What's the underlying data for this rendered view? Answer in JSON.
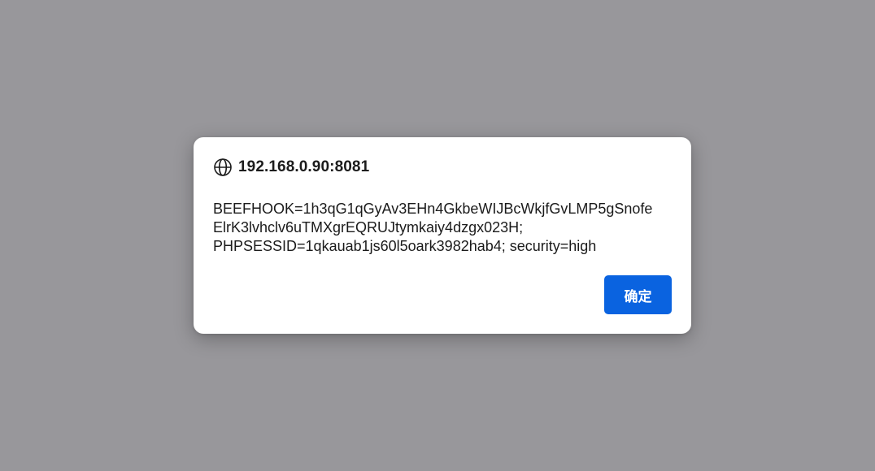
{
  "dialog": {
    "origin": "192.168.0.90:8081",
    "origin_icon": "globe-icon",
    "message_lines": [
      "BEEFHOOK=1h3qG1qGyAv3EHn4GkbeWIJBcWkjfGvLMP5gSnofe",
      "ElrK3lvhclv6uTMXgrEQRUJtymkaiy4dzgx023H;",
      "PHPSESSID=1qkauab1js60l5oark3982hab4; security=high"
    ],
    "ok_label": "确定"
  },
  "colors": {
    "backdrop": "#98979b",
    "dialog_background": "#ffffff",
    "button_accent": "#0a63e0",
    "text": "#1b1b1b"
  }
}
